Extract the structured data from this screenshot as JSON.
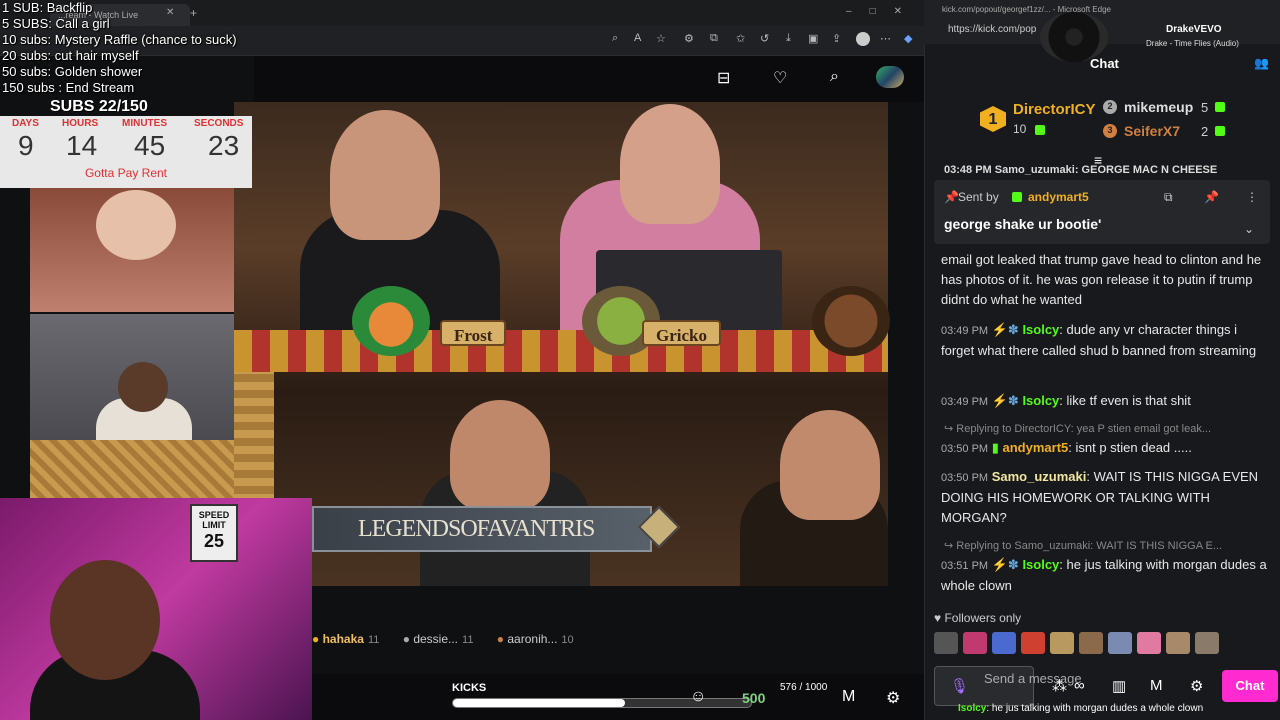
{
  "browser": {
    "tab_title": "...ream - Watch Live",
    "chat_url_title": "kick.com/popout/georgef1zz/... - Microsoft Edge",
    "chat_url": "https://kick.com/pop"
  },
  "overlay": {
    "goals": [
      "1 SUB: Backflip",
      "5 SUBS: Call a girl",
      "10 subs: Mystery Raffle (chance to suck)",
      "20 subs: cut hair myself",
      "50 subs: Golden shower",
      "150 subs : End Stream"
    ],
    "subs": "SUBS 22/150",
    "timer": {
      "days_label": "DAYS",
      "hours_label": "HOURS",
      "minutes_label": "MINUTES",
      "seconds_label": "SECONDS",
      "days": "9",
      "hours": "14",
      "minutes": "45",
      "seconds": "23"
    },
    "pay_rent": "Gotta Pay Rent",
    "sign_top": "SPEED LIMIT",
    "sign_num": "25"
  },
  "video": {
    "name_frost": "Frost",
    "name_gricko": "Gricko",
    "banner": "LEGENDSOFAVANTRIS"
  },
  "leaderboard_strip": [
    {
      "name": "hahaka",
      "count": "11"
    },
    {
      "name": "dessie...",
      "count": "11"
    },
    {
      "name": "aaronih...",
      "count": "10"
    }
  ],
  "footer": {
    "kicks_label": "KICKS",
    "kicks_count": "576 / 1000",
    "kicks_progress": 0.576,
    "kicks_amount": "500"
  },
  "music": {
    "artist": "DrakeVEVO",
    "song": "Drake - Time Flies (Audio)"
  },
  "chat": {
    "title": "Chat",
    "leaders": [
      {
        "rank": "1",
        "name": "DirectorICY",
        "count": "10"
      },
      {
        "rank": "2",
        "name": "mikemeup",
        "count": "5"
      },
      {
        "rank": "3",
        "name": "SeiferX7",
        "count": "2"
      }
    ],
    "pinned_preview": "03:48 PM Samo_uzumaki: GEORGE MAC N CHEESE",
    "pinned_sent_by": "Sent by",
    "pinned_user": "andymart5",
    "pinned_msg": "george shake ur bootie'",
    "messages": [
      {
        "ts": "",
        "user": "",
        "text": "email got leaked that trump gave head to clinton and he has photos of it. he was gon release it to putin if trump didnt do what he wanted"
      },
      {
        "ts": "03:49 PM",
        "user": "Isolcy",
        "text": ": dude any vr character things i forget what there called shud b banned from streaming"
      },
      {
        "ts": "03:49 PM",
        "user": "Isolcy",
        "text": ": like tf even is that shit"
      },
      {
        "reply": "Replying to DirectorICY: yea P stien email got leak..."
      },
      {
        "ts": "03:50 PM",
        "user": "andymart5",
        "text": ": isnt p stien dead ....."
      },
      {
        "ts": "03:50 PM",
        "user": "Samo_uzumaki",
        "text": ": WAIT IS THIS NIGGA EVEN DOING HIS HOMEWORK OR TALKING WITH MORGAN?"
      },
      {
        "reply": "Replying to Samo_uzumaki: WAIT IS THIS NIGGA E..."
      },
      {
        "ts": "03:51 PM",
        "user": "Isolcy",
        "text": ": he jus talking with morgan dudes a whole clown"
      }
    ],
    "followers_only": "Followers only",
    "input_placeholder": "Send a message",
    "chat_button": "Chat",
    "ticker_user": "Isolcy",
    "ticker_text": ": he jus talking with morgan dudes a whole clown"
  },
  "colors": {
    "kick_green": "#53fc18",
    "gold": "#f0b020",
    "pink": "#ff2ad0"
  }
}
